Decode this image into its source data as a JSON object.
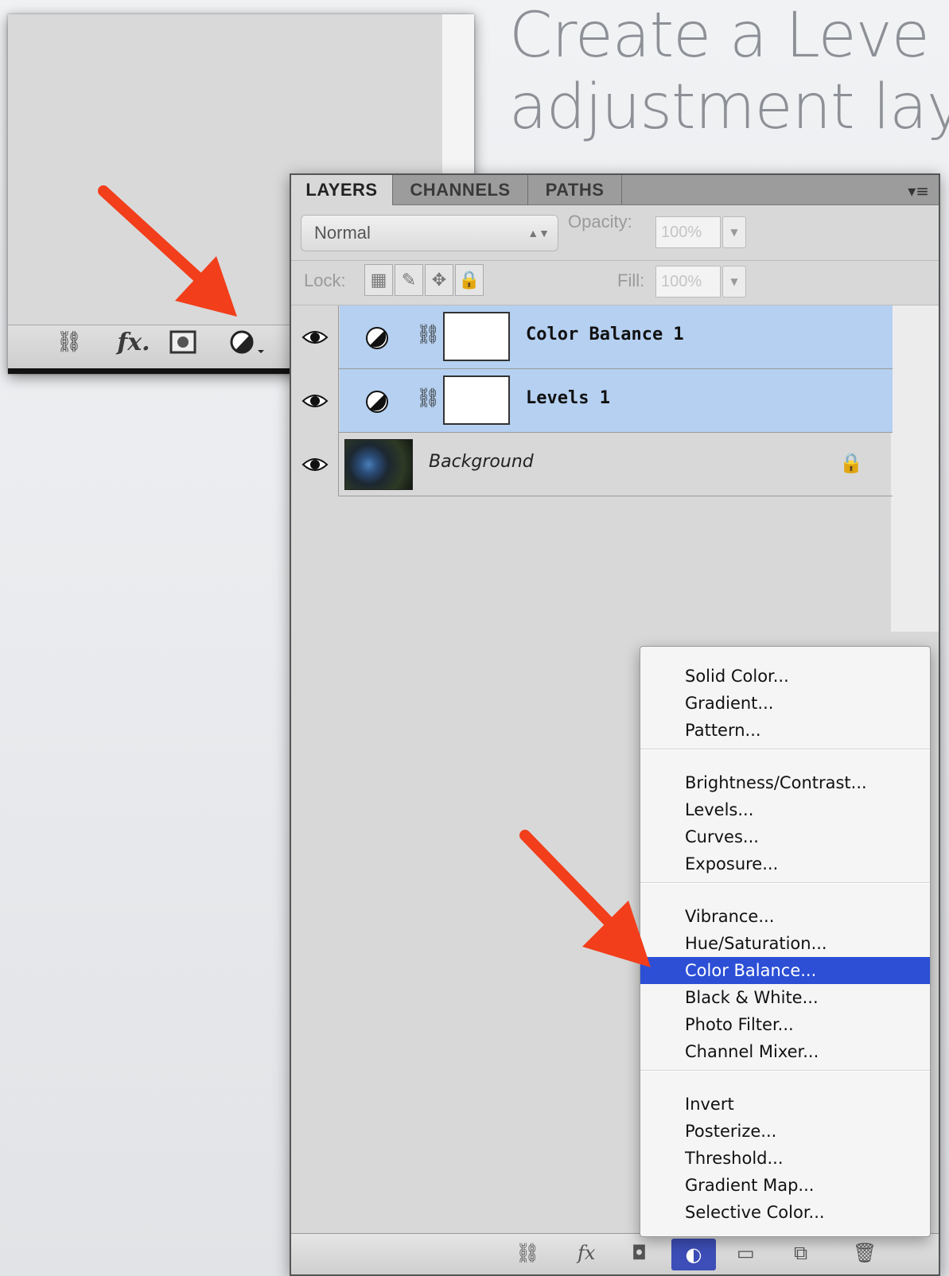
{
  "headline": {
    "line1": "Create a Leve",
    "line2": "adjustment lay"
  },
  "zoom_toolbar": {
    "link_icon": "⛓",
    "fx_label": "fx.",
    "mask_icon": "□",
    "adjust_icon": "◐."
  },
  "panel": {
    "tabs": [
      "LAYERS",
      "CHANNELS",
      "PATHS"
    ],
    "menu_icon": "▾≡",
    "blend_mode": "Normal",
    "opacity_label": "Opacity:",
    "opacity_value": "100%",
    "lock_label": "Lock:",
    "fill_label": "Fill:",
    "fill_value": "100%"
  },
  "layers": [
    {
      "name": "Color Balance 1",
      "type": "adjustment",
      "selected": true
    },
    {
      "name": "Levels 1",
      "type": "adjustment",
      "selected": true
    },
    {
      "name": "Background",
      "type": "image",
      "selected": false,
      "locked": true
    }
  ],
  "menu": {
    "groups": [
      [
        "Solid Color...",
        "Gradient...",
        "Pattern..."
      ],
      [
        "Brightness/Contrast...",
        "Levels...",
        "Curves...",
        "Exposure..."
      ],
      [
        "Vibrance...",
        "Hue/Saturation...",
        "Color Balance...",
        "Black & White...",
        "Photo Filter...",
        "Channel Mixer..."
      ],
      [
        "Invert",
        "Posterize...",
        "Threshold...",
        "Gradient Map...",
        "Selective Color..."
      ]
    ],
    "highlighted": "Color Balance...",
    "highlight_color": "#2c4fd6"
  },
  "bottom_toolbar": {
    "link_icon": "⛓",
    "fx_label": "fx"
  },
  "arrow_color": "#f23e1b"
}
